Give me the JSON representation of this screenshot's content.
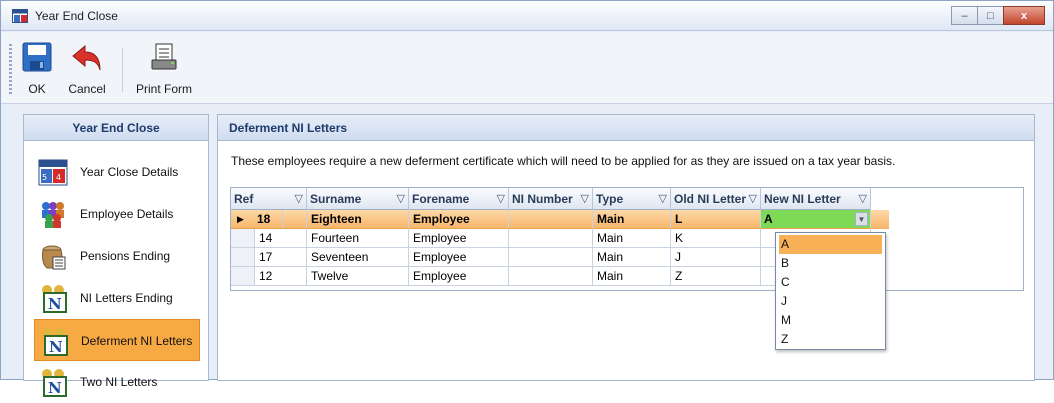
{
  "window": {
    "title": "Year End Close",
    "minimize": "–",
    "maximize": "□",
    "close": "x"
  },
  "toolbar": {
    "ok_label": "OK",
    "cancel_label": "Cancel",
    "print_label": "Print Form"
  },
  "left_panel": {
    "header": "Year End Close",
    "items": [
      {
        "label": "Year Close Details",
        "icon": "calendar-icon"
      },
      {
        "label": "Employee Details",
        "icon": "people-icon"
      },
      {
        "label": "Pensions Ending",
        "icon": "pension-jar-icon"
      },
      {
        "label": "NI Letters Ending",
        "icon": "ni-crest-icon"
      },
      {
        "label": "Deferment NI Letters",
        "icon": "ni-crest-icon",
        "selected": true
      },
      {
        "label": "Two NI Letters",
        "icon": "ni-crest-icon"
      }
    ]
  },
  "right_panel": {
    "header": "Deferment NI Letters",
    "description": "These employees require a new deferment certificate which will need to be applied for as they are issued on a tax year basis."
  },
  "grid": {
    "columns": [
      "Ref",
      "Surname",
      "Forename",
      "NI Number",
      "Type",
      "Old NI Letter",
      "New NI Letter"
    ],
    "filter_glyph": "▽",
    "row_indicator": "▶",
    "rows": [
      {
        "ref": "18",
        "surname": "Eighteen",
        "forename": "Employee",
        "ni_number": "",
        "type": "Main",
        "old_ni": "L",
        "new_ni": "A"
      },
      {
        "ref": "14",
        "surname": "Fourteen",
        "forename": "Employee",
        "ni_number": "",
        "type": "Main",
        "old_ni": "K",
        "new_ni": ""
      },
      {
        "ref": "17",
        "surname": "Seventeen",
        "forename": "Employee",
        "ni_number": "",
        "type": "Main",
        "old_ni": "J",
        "new_ni": ""
      },
      {
        "ref": "12",
        "surname": "Twelve",
        "forename": "Employee",
        "ni_number": "",
        "type": "Main",
        "old_ni": "Z",
        "new_ni": ""
      }
    ]
  },
  "dropdown": {
    "options": [
      "A",
      "B",
      "C",
      "J",
      "M",
      "Z"
    ],
    "selected": "A"
  },
  "colors": {
    "selected_nav": "#f7a944",
    "active_row": "#f7b468",
    "edit_cell": "#7ed957",
    "header_text": "#1d3a6b"
  }
}
